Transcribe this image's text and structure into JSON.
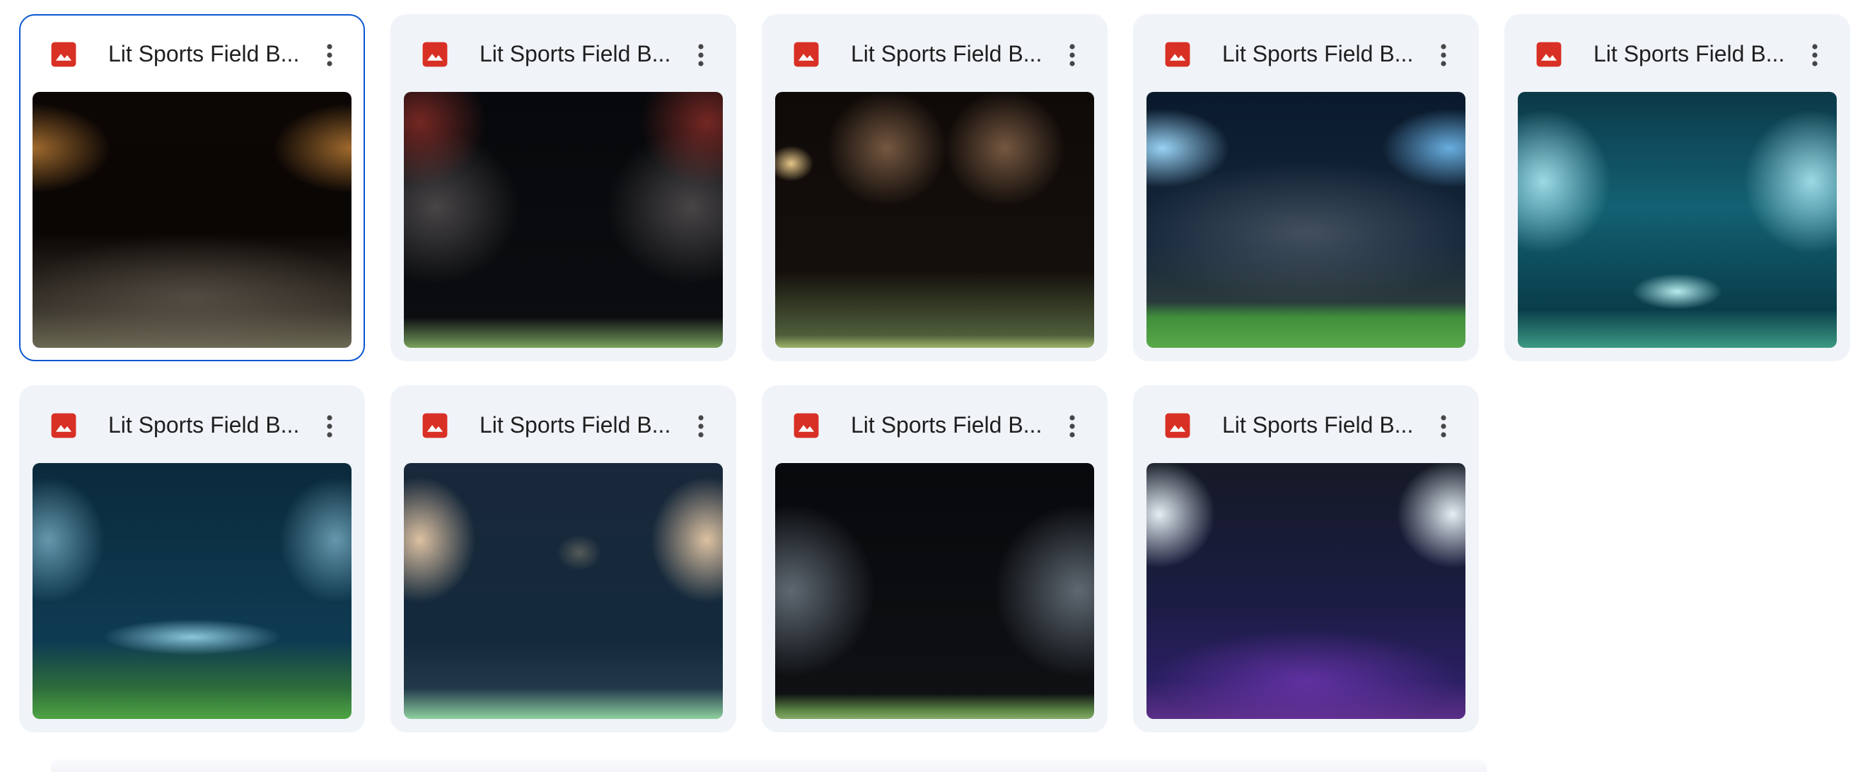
{
  "files": [
    {
      "title": "Lit Sports Field B...",
      "icon": "image-file-icon",
      "selected": true,
      "thumb": "t1"
    },
    {
      "title": "Lit Sports Field B...",
      "icon": "image-file-icon",
      "selected": false,
      "thumb": "t2"
    },
    {
      "title": "Lit Sports Field B...",
      "icon": "image-file-icon",
      "selected": false,
      "thumb": "t3"
    },
    {
      "title": "Lit Sports Field B...",
      "icon": "image-file-icon",
      "selected": false,
      "thumb": "t4"
    },
    {
      "title": "Lit Sports Field B...",
      "icon": "image-file-icon",
      "selected": false,
      "thumb": "t5"
    },
    {
      "title": "Lit Sports Field B...",
      "icon": "image-file-icon",
      "selected": false,
      "thumb": "t6"
    },
    {
      "title": "Lit Sports Field B...",
      "icon": "image-file-icon",
      "selected": false,
      "thumb": "t7"
    },
    {
      "title": "Lit Sports Field B...",
      "icon": "image-file-icon",
      "selected": false,
      "thumb": "t8"
    },
    {
      "title": "Lit Sports Field B...",
      "icon": "image-file-icon",
      "selected": false,
      "thumb": "t9"
    }
  ],
  "colors": {
    "card_background": "#f0f4f9",
    "selected_border": "#0b57d0",
    "image_icon_red": "#d93025",
    "text": "#1f1f1f"
  }
}
